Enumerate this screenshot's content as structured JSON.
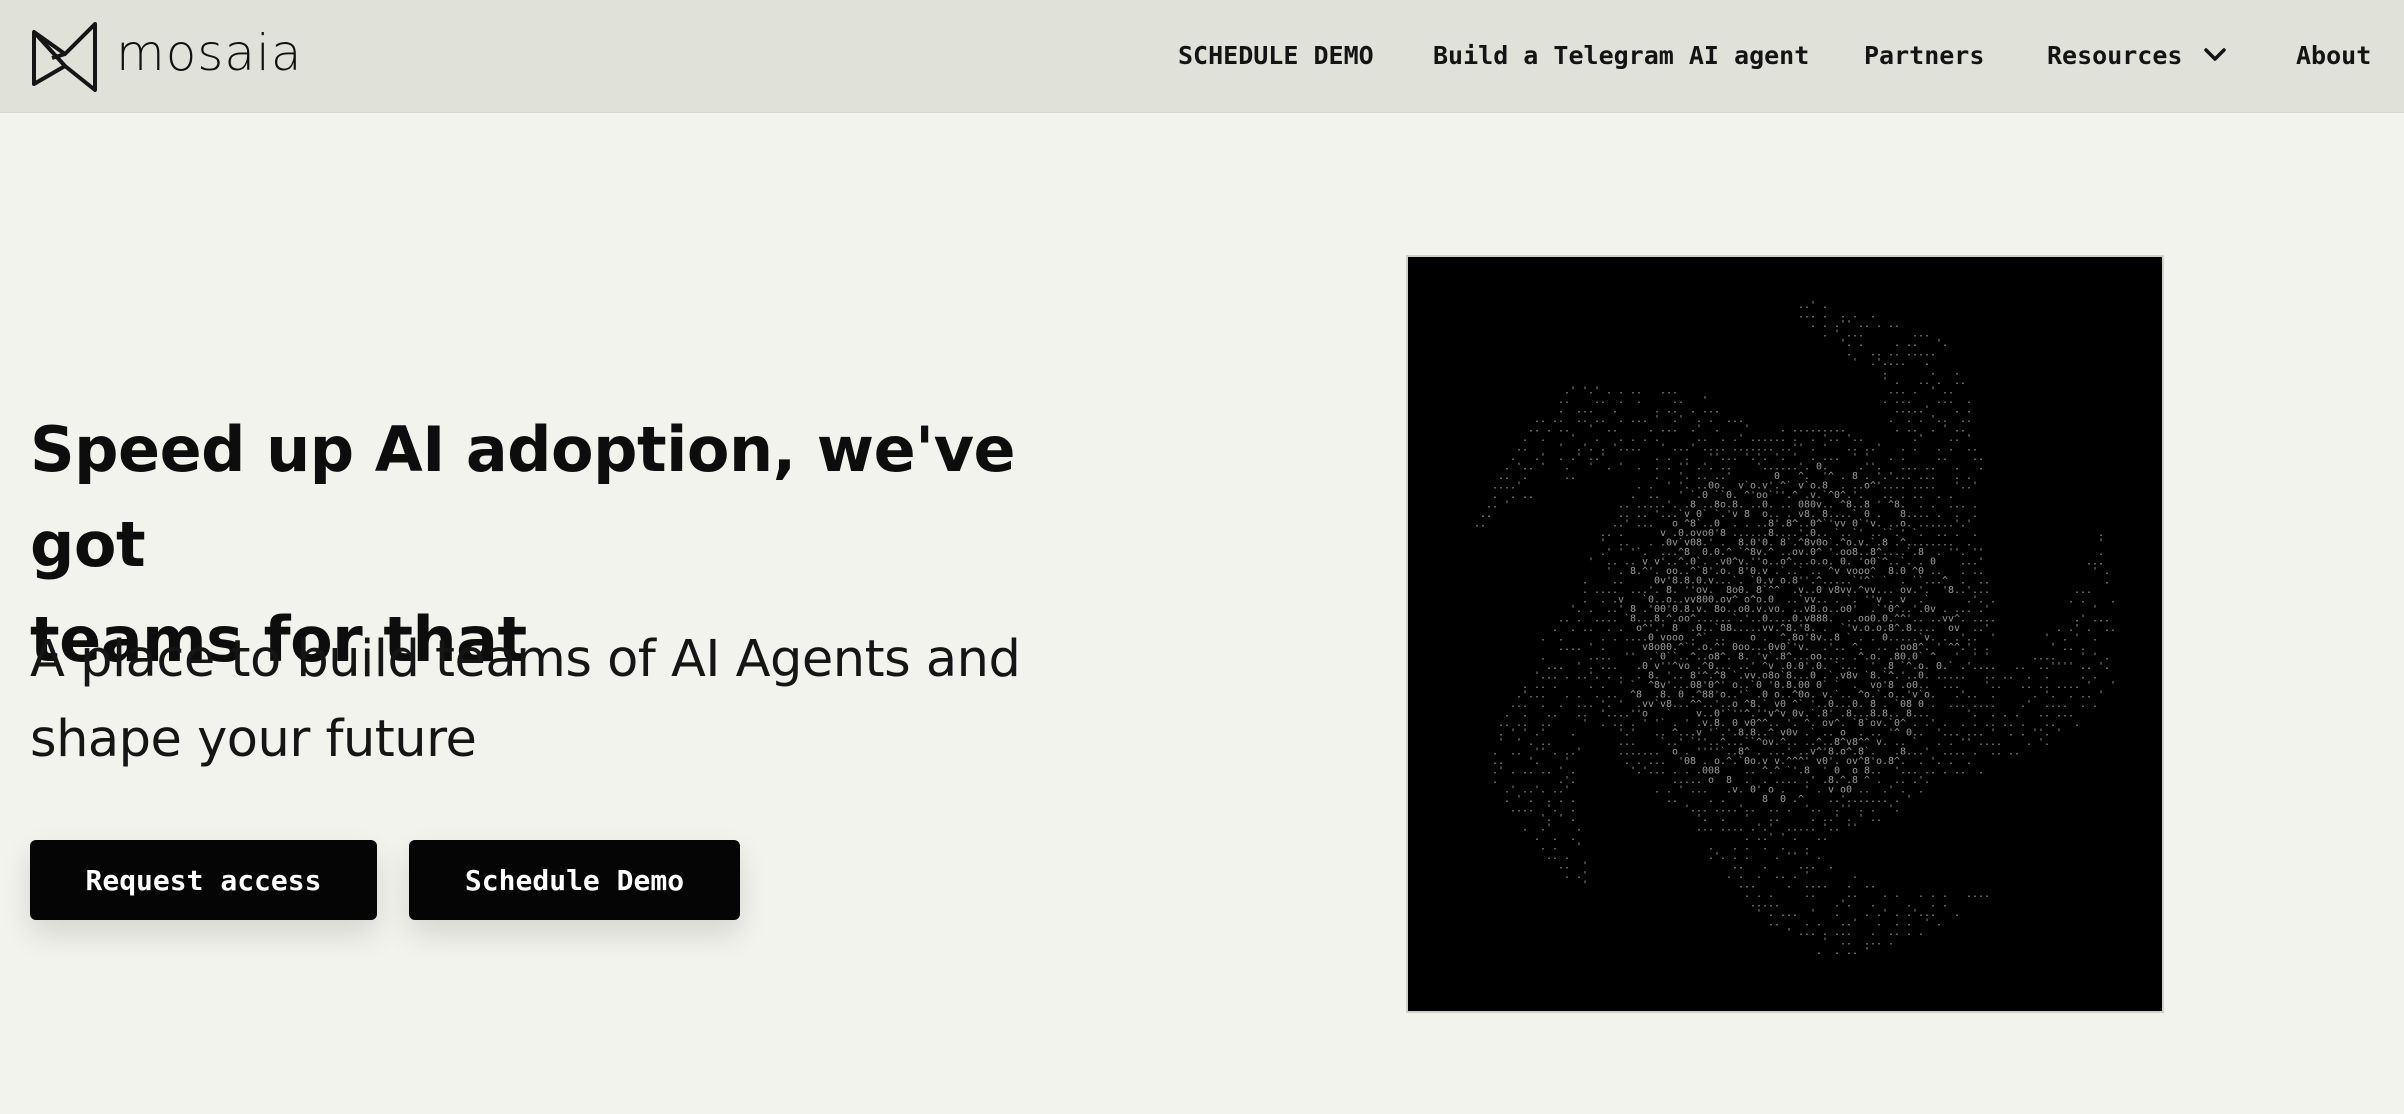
{
  "brand": {
    "name": "mosaia",
    "logo_icon": "bowtie-logo-icon"
  },
  "nav": {
    "schedule_demo": "SCHEDULE DEMO",
    "telegram": "Build a Telegram AI agent",
    "partners": "Partners",
    "resources": "Resources",
    "resources_icon": "chevron-down-icon",
    "about": "About"
  },
  "hero": {
    "headline_line1": "Speed up AI adoption, we've got",
    "headline_line2": "teams for that",
    "subhead_line1": "A place to build teams of AI Agents and",
    "subhead_line2": "shape your future",
    "request_access_label": "Request access",
    "schedule_demo_label": "Schedule Demo"
  },
  "art": {
    "description_icon": "ascii-globe-art",
    "background": "#000000",
    "glyph_color": "#9a9a9a"
  }
}
